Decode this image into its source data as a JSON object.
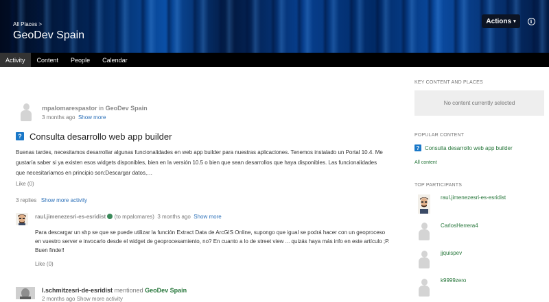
{
  "header": {
    "breadcrumb": "All Places >",
    "title": "GeoDev Spain",
    "actions_label": "Actions",
    "actions_caret": "▾",
    "info_icon": "info-icon"
  },
  "nav": {
    "tabs": [
      {
        "label": "Activity",
        "active": true
      },
      {
        "label": "Content"
      },
      {
        "label": "People"
      },
      {
        "label": "Calendar"
      }
    ]
  },
  "post": {
    "author": "mpalomarespastor",
    "in_text": "in",
    "place": "GeoDev Spain",
    "time": "3 months ago",
    "show_more": "Show more",
    "title": "Consulta desarrollo web app builder",
    "body": "Buenas tardes, necesitamos desarrollar algunas funcionalidades en web app builder para nuestras aplicaciones. Tenemos instalado un Portal 10.4. Me gustaría saber si ya existen esos widgets disponibles, bien en la versión 10.5 o bien que sean desarrollos que haya disponibles. Las funcionalidades que necesitaríamos en principio son:Descargar datos,…",
    "like": "Like (0)",
    "replies": "3 replies",
    "show_more_activity": "Show more activity"
  },
  "reply": {
    "author": "raul.jimenezesri-es-esridist",
    "to": "(to mpalomares)",
    "time": "3 months ago",
    "show_more": "Show more",
    "body": "Para descargar un shp se que se puede utilizar la función Extract Data de ArcGIS Online, supongo que igual se podrá hacer con un geoproceso en vuestro server e invocarlo desde el widget de geoprocesamiento, no?   En cuanto a lo de street view ... quizás haya más info en este artículo ;P.   Buen finde!!",
    "like": "Like (0)"
  },
  "mention": {
    "author": "l.schmitzesri-de-esridist",
    "text": "mentioned",
    "place": "GeoDev Spain",
    "time_partial": "2 months ago  Show more activity"
  },
  "sidebar": {
    "key_content_heading": "KEY CONTENT AND PLACES",
    "no_content": "No content currently selected",
    "popular_heading": "POPULAR CONTENT",
    "popular_items": [
      "Consulta desarrollo web app builder"
    ],
    "all_content": "All content",
    "participants_heading": "TOP PARTICIPANTS",
    "participants": [
      "raul.jimenezesri-es-esridist",
      "CarlosHerrera4",
      "jjquispev",
      "k9999zero"
    ]
  },
  "colors": {
    "link_blue": "#2a6fb8",
    "link_green": "#26763a",
    "question_icon": "#1a78c8",
    "nav_bg": "#000000"
  }
}
